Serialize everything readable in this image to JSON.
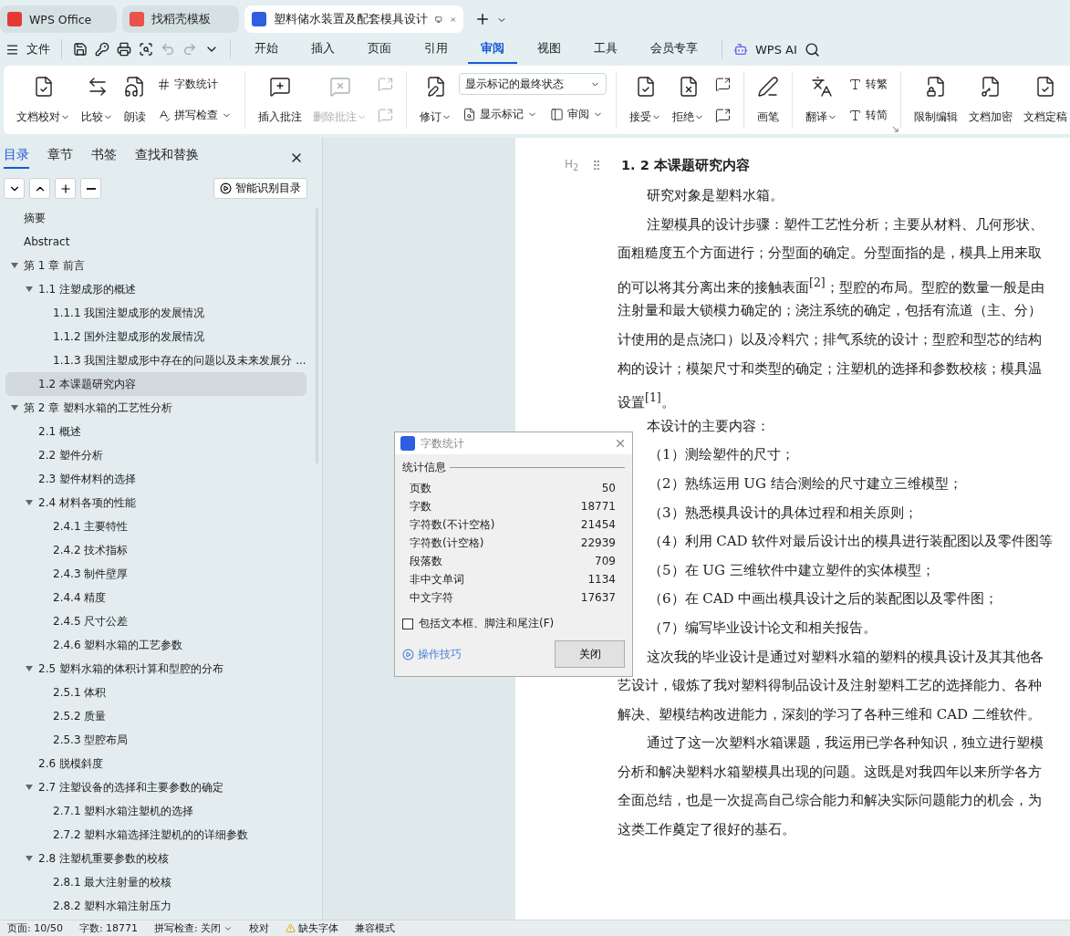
{
  "app_tabs": [
    {
      "label": "WPS Office",
      "selected": false
    },
    {
      "label": "找稻壳模板",
      "selected": false
    },
    {
      "label": "塑料储水装置及配套模具设计",
      "selected": true
    }
  ],
  "file_menu": "文件",
  "menu_tabs": [
    {
      "label": "开始",
      "selected": false
    },
    {
      "label": "插入",
      "selected": false
    },
    {
      "label": "页面",
      "selected": false
    },
    {
      "label": "引用",
      "selected": false
    },
    {
      "label": "审阅",
      "selected": true
    },
    {
      "label": "视图",
      "selected": false
    },
    {
      "label": "工具",
      "selected": false
    },
    {
      "label": "会员专享",
      "selected": false
    }
  ],
  "ai_label": "WPS AI",
  "ribbon": [
    {
      "columns": [
        [
          {
            "kind": "large",
            "label": "文档校对",
            "dropdown": true,
            "disabled": false
          }
        ],
        [
          {
            "kind": "large",
            "label": "比较",
            "dropdown": true,
            "disabled": false
          }
        ],
        [
          {
            "kind": "large",
            "label": "朗读",
            "dropdown": false,
            "disabled": false
          }
        ],
        [
          {
            "kind": "small",
            "label": "字数统计",
            "dropdown": false,
            "disabled": false
          },
          {
            "kind": "small",
            "label": "拼写检查",
            "dropdown": true,
            "disabled": false
          }
        ]
      ]
    },
    {
      "columns": [
        [
          {
            "kind": "large",
            "label": "插入批注",
            "dropdown": false,
            "disabled": false
          }
        ],
        [
          {
            "kind": "large",
            "label": "删除批注",
            "dropdown": true,
            "disabled": true
          }
        ],
        [
          {
            "kind": "icon",
            "disabled": true
          },
          {
            "kind": "icon",
            "disabled": true
          }
        ]
      ]
    },
    {
      "columns": [
        [
          {
            "kind": "large",
            "label": "修订",
            "dropdown": true,
            "disabled": false
          }
        ],
        [
          {
            "kind": "select",
            "label": "显示标记的最终状态"
          },
          {
            "kind": "pair",
            "items": [
              {
                "label": "显示标记",
                "dropdown": true,
                "disabled": false
              },
              {
                "label": "审阅",
                "dropdown": true,
                "disabled": false
              }
            ]
          }
        ]
      ]
    },
    {
      "columns": [
        [
          {
            "kind": "large",
            "label": "接受",
            "dropdown": true,
            "disabled": false
          }
        ],
        [
          {
            "kind": "large",
            "label": "拒绝",
            "dropdown": true,
            "disabled": false
          }
        ],
        [
          {
            "kind": "icon",
            "disabled": false
          },
          {
            "kind": "icon",
            "disabled": false
          }
        ]
      ]
    },
    {
      "columns": [
        [
          {
            "kind": "large",
            "label": "画笔",
            "dropdown": false,
            "disabled": false
          }
        ]
      ]
    },
    {
      "launcher": true,
      "columns": [
        [
          {
            "kind": "large",
            "label": "翻译",
            "dropdown": true,
            "disabled": false
          }
        ],
        [
          {
            "kind": "small",
            "label": "转繁",
            "dropdown": false,
            "disabled": false
          },
          {
            "kind": "small",
            "label": "转简",
            "dropdown": false,
            "disabled": false
          }
        ]
      ]
    },
    {
      "columns": [
        [
          {
            "kind": "large",
            "label": "限制编辑",
            "dropdown": false,
            "disabled": false
          }
        ],
        [
          {
            "kind": "large",
            "label": "文档加密",
            "dropdown": false,
            "disabled": false
          }
        ],
        [
          {
            "kind": "large",
            "label": "文档定稿",
            "dropdown": false,
            "disabled": false
          }
        ]
      ]
    }
  ],
  "side_panel": {
    "tabs": [
      {
        "label": "目录",
        "selected": true
      },
      {
        "label": "章节",
        "selected": false
      },
      {
        "label": "书签",
        "selected": false
      },
      {
        "label": "查找和替换",
        "selected": false
      }
    ],
    "smart_button": "智能识别目录",
    "toc": [
      {
        "label": "摘要",
        "selected": false
      },
      {
        "label": "Abstract",
        "selected": false
      },
      {
        "label": "第 1 章  前言",
        "selected": false,
        "expanded": true,
        "children": [
          {
            "label": "1.1 注塑成形的概述",
            "selected": false,
            "expanded": true,
            "children": [
              {
                "label": "1.1.1 我国注塑成形的发展情况",
                "selected": false
              },
              {
                "label": "1.1.2 国外注塑成形的发展情况",
                "selected": false
              },
              {
                "label": "1.1.3 我国注塑成形中存在的问题以及未来发展分 ...",
                "selected": false
              }
            ]
          },
          {
            "label": "1.2 本课题研究内容",
            "selected": true
          }
        ]
      },
      {
        "label": "第 2 章  塑料水箱的工艺性分析",
        "selected": false,
        "expanded": true,
        "children": [
          {
            "label": "2.1 概述",
            "selected": false
          },
          {
            "label": "2.2 塑件分析",
            "selected": false
          },
          {
            "label": "2.3  塑件材料的选择",
            "selected": false
          },
          {
            "label": "2.4  材料各项的性能",
            "selected": false,
            "expanded": true,
            "children": [
              {
                "label": "2.4.1  主要特性",
                "selected": false
              },
              {
                "label": "2.4.2  技术指标",
                "selected": false
              },
              {
                "label": "2.4.3  制件壁厚",
                "selected": false
              },
              {
                "label": "2.4.4  精度",
                "selected": false
              },
              {
                "label": "2.4.5  尺寸公差",
                "selected": false
              },
              {
                "label": "2.4.6 塑料水箱的工艺参数",
                "selected": false
              }
            ]
          },
          {
            "label": "2.5 塑料水箱的体积计算和型腔的分布",
            "selected": false,
            "expanded": true,
            "children": [
              {
                "label": "2.5.1  体积",
                "selected": false
              },
              {
                "label": "2.5.2 质量",
                "selected": false
              },
              {
                "label": "2.5.3 型腔布局",
                "selected": false
              }
            ]
          },
          {
            "label": "2.6  脱模斜度",
            "selected": false
          },
          {
            "label": "2.7  注塑设备的选择和主要参数的确定",
            "selected": false,
            "expanded": true,
            "children": [
              {
                "label": "2.7.1 塑料水箱注塑机的选择",
                "selected": false
              },
              {
                "label": "2.7.2 塑料水箱选择注塑机的的详细参数",
                "selected": false
              }
            ]
          },
          {
            "label": "2.8 注塑机重要参数的校核",
            "selected": false,
            "expanded": true,
            "children": [
              {
                "label": "2.8.1 最大注射量的校核",
                "selected": false
              },
              {
                "label": "2.8.2 塑料水箱注射压力",
                "selected": false
              }
            ]
          }
        ]
      }
    ]
  },
  "document": {
    "heading_marker": "H$_{2}$",
    "heading": "1. 2 本课题研究内容",
    "lines": [
      {
        "kind": "indent",
        "text": "研究对象是塑料水箱。"
      },
      {
        "kind": "indent",
        "text": "注塑模具的设计步骤：塑件工艺性分析；主要从材料、几何形状、"
      },
      {
        "kind": "plain",
        "text": "面粗糙度五个方面进行；分型面的确定。分型面指的是，模具上用来取"
      },
      {
        "kind": "plain",
        "text": "的可以将其分离出来的接触表面$^{[2]}$；型腔的布局。型腔的数量一般是由"
      },
      {
        "kind": "plain",
        "text": "注射量和最大锁模力确定的；浇注系统的确定，包括有流道（主、分）"
      },
      {
        "kind": "plain",
        "text": "计使用的是点浇口）以及冷料穴；排气系统的设计；型腔和型芯的结构"
      },
      {
        "kind": "plain",
        "text": "构的设计；模架尺寸和类型的确定；注塑机的选择和参数校核；模具温"
      },
      {
        "kind": "plain",
        "text": "设置$^{[1]}$。"
      },
      {
        "kind": "indent",
        "text": "本设计的主要内容："
      },
      {
        "kind": "item",
        "text": "（1）测绘塑件的尺寸；"
      },
      {
        "kind": "item",
        "text": "（2）熟练运用 UG 结合测绘的尺寸建立三维模型；"
      },
      {
        "kind": "item",
        "text": "（3）熟悉模具设计的具体过程和相关原则；"
      },
      {
        "kind": "item",
        "text": "（4）利用 CAD 软件对最后设计出的模具进行装配图以及零件图等"
      },
      {
        "kind": "item",
        "text": "（5）在 UG 三维软件中建立塑件的实体模型；"
      },
      {
        "kind": "item",
        "text": "（6）在 CAD 中画出模具设计之后的装配图以及零件图；"
      },
      {
        "kind": "item",
        "text": "（7）编写毕业设计论文和相关报告。"
      },
      {
        "kind": "indent",
        "text": "这次我的毕业设计是通过对塑料水箱的塑料的模具设计及其其他各"
      },
      {
        "kind": "plain",
        "text": "艺设计，锻炼了我对塑料得制品设计及注射塑料工艺的选择能力、各种"
      },
      {
        "kind": "plain",
        "text": "解决、塑模结构改进能力，深刻的学习了各种三维和 CAD 二维软件。"
      },
      {
        "kind": "indent",
        "text": "通过了这一次塑料水箱课题，我运用已学各种知识，独立进行塑模"
      },
      {
        "kind": "plain",
        "text": "分析和解决塑料水箱塑模具出现的问题。这既是对我四年以来所学各方"
      },
      {
        "kind": "plain",
        "text": "全面总结，也是一次提高自己综合能力和解决实际问题能力的机会，为"
      },
      {
        "kind": "plain",
        "text": "这类工作奠定了很好的基石。"
      }
    ]
  },
  "dialog": {
    "title": "字数统计",
    "group": "统计信息",
    "rows": [
      {
        "label": "页数",
        "value": "50"
      },
      {
        "label": "字数",
        "value": "18771"
      },
      {
        "label": "字符数(不计空格)",
        "value": "21454"
      },
      {
        "label": "字符数(计空格)",
        "value": "22939"
      },
      {
        "label": "段落数",
        "value": "709"
      },
      {
        "label": "非中文单词",
        "value": "1134"
      },
      {
        "label": "中文字符",
        "value": "17637"
      }
    ],
    "checkbox": {
      "label": "包括文本框、脚注和尾注(F)",
      "checked": false
    },
    "tips_link": "操作技巧",
    "close_button": "关闭"
  },
  "status_bar": [
    {
      "kind": "text",
      "label": "页面: 10/50"
    },
    {
      "kind": "text",
      "label": "字数: 18771"
    },
    {
      "kind": "dropdown",
      "label": "拼写检查: 关闭"
    },
    {
      "kind": "text",
      "label": "校对"
    },
    {
      "kind": "warning",
      "label": "缺失字体"
    },
    {
      "kind": "text",
      "label": "兼容模式"
    }
  ]
}
